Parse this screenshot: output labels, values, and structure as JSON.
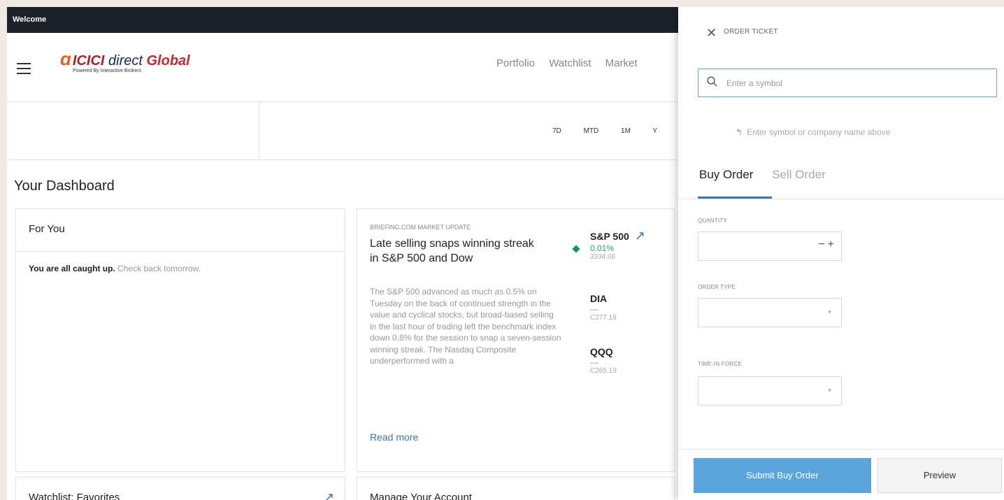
{
  "welcome": "Welcome",
  "logo": {
    "brand": "ICICI",
    "direct": "direct",
    "global": "Global",
    "tagline": "Powered By Interactive Brokers"
  },
  "nav": {
    "items": [
      "Portfolio",
      "Watchlist",
      "Market"
    ]
  },
  "ranges": [
    "7D",
    "MTD",
    "1M",
    "Y"
  ],
  "dashboard": {
    "title": "Your Dashboard"
  },
  "for_you": {
    "title": "For You",
    "caught_up": "You are all caught up.",
    "check_back": "Check back tomorrow."
  },
  "briefing": {
    "kicker": "BRIEFING.COM MARKET UPDATE",
    "headline": "Late selling snaps winning streak in S&P 500 and Dow",
    "body": "The S&P 500 advanced as much as 0.5% on Tuesday on the back of continued strength in the value and cyclical stocks, but broad-based selling in the last hour of trading left the benchmark index down 0.8% for the session to snap a seven-session winning streak. The Nasdaq Composite underperformed with a",
    "read_more": "Read more",
    "tickers": [
      {
        "symbol": "S&P 500",
        "change": "0.01%",
        "price": "3334.08"
      },
      {
        "symbol": "DIA",
        "change": "—",
        "price": "C277.19"
      },
      {
        "symbol": "QQQ",
        "change": "—",
        "price": "C265.19"
      }
    ]
  },
  "watchlist": {
    "title": "Watchlist: Favorites"
  },
  "manage": {
    "title": "Manage Your Account"
  },
  "order_ticket": {
    "title": "ORDER TICKET",
    "search_placeholder": "Enter a symbol",
    "hint": "Enter symbol or company name above",
    "tabs": {
      "buy": "Buy Order",
      "sell": "Sell Order"
    },
    "quantity_label": "QUANTITY",
    "order_type_label": "ORDER TYPE",
    "tif_label": "TIME-IN-FORCE",
    "submit": "Submit Buy Order",
    "preview": "Preview"
  },
  "colors": {
    "brand_red": "#a0262f",
    "accent_blue": "#5aa6dc",
    "link_blue": "#3a77b5",
    "up_green": "#2aa676",
    "topbar": "#1d2129"
  }
}
